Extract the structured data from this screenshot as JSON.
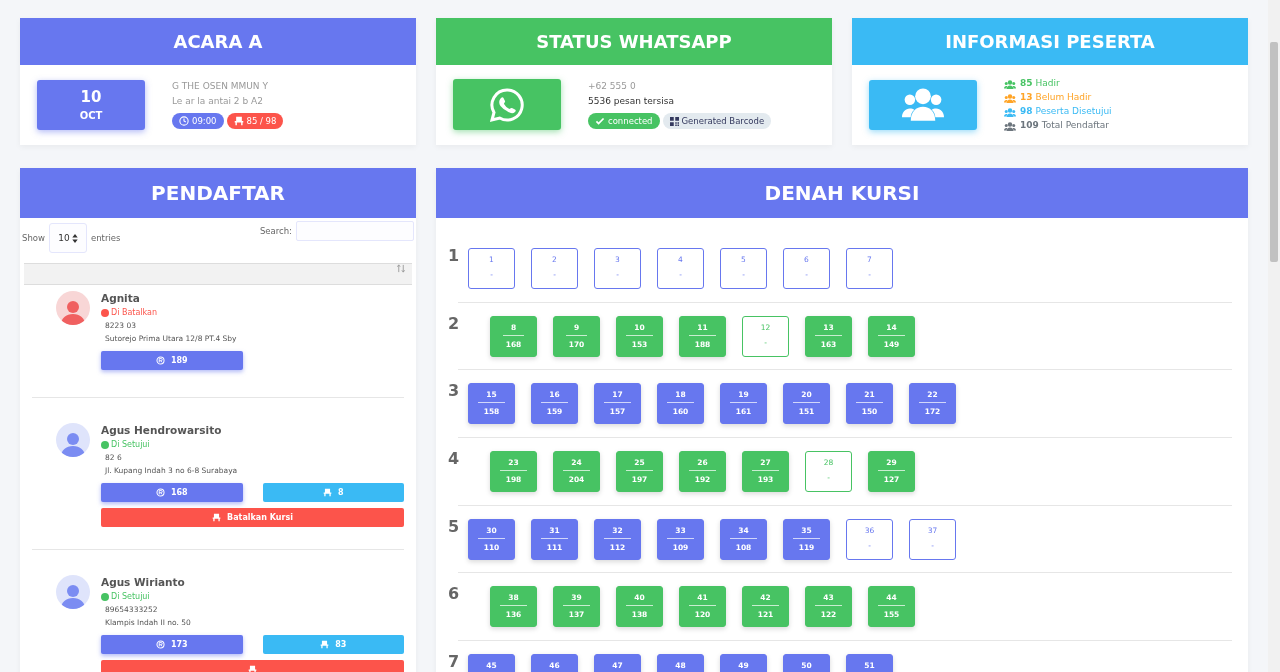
{
  "event_card": {
    "title": "ACARA A",
    "day": "10",
    "month": "OCT",
    "name": "G  THE  OSEN  MMUN  Y",
    "place": "Le  ar  la  antai 2 b  A2",
    "time": "09:00",
    "seats": "85 / 98"
  },
  "whatsapp_card": {
    "title": "STATUS WHATSAPP",
    "phone": "+62  555  0",
    "quota": "5536 pesan tersisa",
    "connected": true,
    "status": "connected",
    "barcode_button": "Generated Barcode"
  },
  "info_card": {
    "title": "INFORMASI PESERTA",
    "stats": [
      {
        "count": "85",
        "label": "Hadir",
        "color": "#47c363"
      },
      {
        "count": "13",
        "label": "Belum Hadir",
        "color": "#ffa426"
      },
      {
        "count": "98",
        "label": "Peserta Disetujui",
        "color": "#3abaf4"
      },
      {
        "count": "109",
        "label": "Total Pendaftar",
        "color": "#6c757d"
      }
    ]
  },
  "registrants": {
    "title": "PENDAFTAR",
    "show_label": "Show",
    "page_size": "10",
    "entries_label": "entries",
    "search_label": "Search:",
    "items": [
      {
        "name": "Agnita",
        "approved": false,
        "status": "Di Batalkan",
        "phone": "8223  03",
        "address": "Sutorejo Prima Utara 12/8 PT.4 Sby",
        "number": "189"
      },
      {
        "name": "Agus Hendrowarsito",
        "approved": true,
        "status": "Di Setujui",
        "phone": "82  6",
        "address": "Jl. Kupang Indah 3 no 6-8 Surabaya",
        "number": "168",
        "seat": "8",
        "cancel": true,
        "cancel_label": "Batalkan Kursi"
      },
      {
        "name": "Agus Wirianto",
        "approved": true,
        "status": "Di Setujui",
        "phone": "89654333252",
        "address": "Klampis Indah II no. 50",
        "number": "173",
        "seat": "83",
        "cancel": true
      }
    ]
  },
  "seat_map": {
    "title": "DENAH KURSI",
    "rows": [
      {
        "label": "1",
        "color": "#6777ef",
        "seats": [
          {
            "number": "1",
            "occupied": false,
            "value": "-"
          },
          {
            "number": "2",
            "occupied": false,
            "value": "-"
          },
          {
            "number": "3",
            "occupied": false,
            "value": "-"
          },
          {
            "number": "4",
            "occupied": false,
            "value": "-"
          },
          {
            "number": "5",
            "occupied": false,
            "value": "-"
          },
          {
            "number": "6",
            "occupied": false,
            "value": "-"
          },
          {
            "number": "7",
            "occupied": false,
            "value": "-"
          }
        ]
      },
      {
        "label": "2",
        "color": "#47c363",
        "seats": [
          {
            "number": "8",
            "occupied": true,
            "value": "168"
          },
          {
            "number": "9",
            "occupied": true,
            "value": "170"
          },
          {
            "number": "10",
            "occupied": true,
            "value": "153"
          },
          {
            "number": "11",
            "occupied": true,
            "value": "188"
          },
          {
            "number": "12",
            "occupied": false,
            "value": "-"
          },
          {
            "number": "13",
            "occupied": true,
            "value": "163"
          },
          {
            "number": "14",
            "occupied": true,
            "value": "149"
          }
        ]
      },
      {
        "label": "3",
        "color": "#6777ef",
        "seats": [
          {
            "number": "15",
            "occupied": true,
            "value": "158"
          },
          {
            "number": "16",
            "occupied": true,
            "value": "159"
          },
          {
            "number": "17",
            "occupied": true,
            "value": "157"
          },
          {
            "number": "18",
            "occupied": true,
            "value": "160"
          },
          {
            "number": "19",
            "occupied": true,
            "value": "161"
          },
          {
            "number": "20",
            "occupied": true,
            "value": "151"
          },
          {
            "number": "21",
            "occupied": true,
            "value": "150"
          },
          {
            "number": "22",
            "occupied": true,
            "value": "172"
          }
        ]
      },
      {
        "label": "4",
        "color": "#47c363",
        "seats": [
          {
            "number": "23",
            "occupied": true,
            "value": "198"
          },
          {
            "number": "24",
            "occupied": true,
            "value": "204"
          },
          {
            "number": "25",
            "occupied": true,
            "value": "197"
          },
          {
            "number": "26",
            "occupied": true,
            "value": "192"
          },
          {
            "number": "27",
            "occupied": true,
            "value": "193"
          },
          {
            "number": "28",
            "occupied": false,
            "value": "-"
          },
          {
            "number": "29",
            "occupied": true,
            "value": "127"
          }
        ]
      },
      {
        "label": "5",
        "color": "#6777ef",
        "seats": [
          {
            "number": "30",
            "occupied": true,
            "value": "110"
          },
          {
            "number": "31",
            "occupied": true,
            "value": "111"
          },
          {
            "number": "32",
            "occupied": true,
            "value": "112"
          },
          {
            "number": "33",
            "occupied": true,
            "value": "109"
          },
          {
            "number": "34",
            "occupied": true,
            "value": "108"
          },
          {
            "number": "35",
            "occupied": true,
            "value": "119"
          },
          {
            "number": "36",
            "occupied": false,
            "value": "-"
          },
          {
            "number": "37",
            "occupied": false,
            "value": "-"
          }
        ]
      },
      {
        "label": "6",
        "color": "#47c363",
        "seats": [
          {
            "number": "38",
            "occupied": true,
            "value": "136"
          },
          {
            "number": "39",
            "occupied": true,
            "value": "137"
          },
          {
            "number": "40",
            "occupied": true,
            "value": "138"
          },
          {
            "number": "41",
            "occupied": true,
            "value": "120"
          },
          {
            "number": "42",
            "occupied": true,
            "value": "121"
          },
          {
            "number": "43",
            "occupied": true,
            "value": "122"
          },
          {
            "number": "44",
            "occupied": true,
            "value": "155"
          }
        ]
      },
      {
        "label": "7",
        "color": "#6777ef",
        "seats": [
          {
            "number": "45",
            "occupied": true
          },
          {
            "number": "46",
            "occupied": true
          },
          {
            "number": "47",
            "occupied": true
          },
          {
            "number": "48",
            "occupied": true
          },
          {
            "number": "49",
            "occupied": true
          },
          {
            "number": "50",
            "occupied": true
          },
          {
            "number": "51",
            "occupied": true
          }
        ]
      }
    ]
  }
}
